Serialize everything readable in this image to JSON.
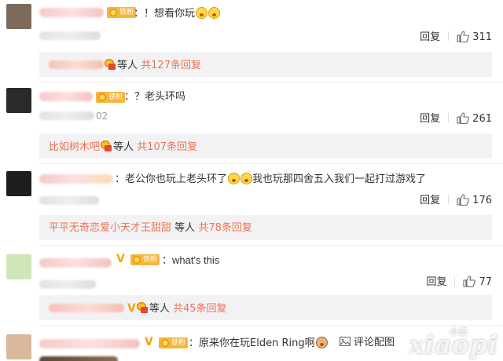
{
  "comments": [
    {
      "text": "：！想看你玩",
      "reply": "回复",
      "likes": "311",
      "sub": {
        "mid": "等人",
        "total": "共127条回复"
      }
    },
    {
      "text": "：？老头环吗",
      "date_tail": "02",
      "reply": "回复",
      "likes": "261",
      "sub": {
        "name": "比如树木吧",
        "mid": "等人",
        "total": "共107条回复"
      }
    },
    {
      "text1": "：老公你也玩上老头环了",
      "text2": "我也玩那四舍五入我们一起打过游戏了",
      "reply": "回复",
      "likes": "176",
      "sub": {
        "name": "平平无奇恋爱小天才王甜甜",
        "mid": "等人",
        "total": "共78条回复"
      }
    },
    {
      "text": "：what's this",
      "reply": "回复",
      "likes": "77",
      "sub": {
        "mid": "等人",
        "total": "共45条回复"
      }
    },
    {
      "text": "：原来你在玩Elden Ring啊",
      "action": "评论配图"
    }
  ],
  "badge_label": "铁粉",
  "vip_mark": "V",
  "colors": {
    "accent_orange": "#eb7350",
    "badge": "#f6b53d",
    "subbox_bg": "#f2f2f5"
  },
  "icons": {
    "like": "thumbs-up-icon",
    "image": "image-icon",
    "medal": "medal-icon",
    "emoji": "emoji-face-icon"
  },
  "watermark": {
    "main": "xiaopi",
    "small": "小皮"
  }
}
